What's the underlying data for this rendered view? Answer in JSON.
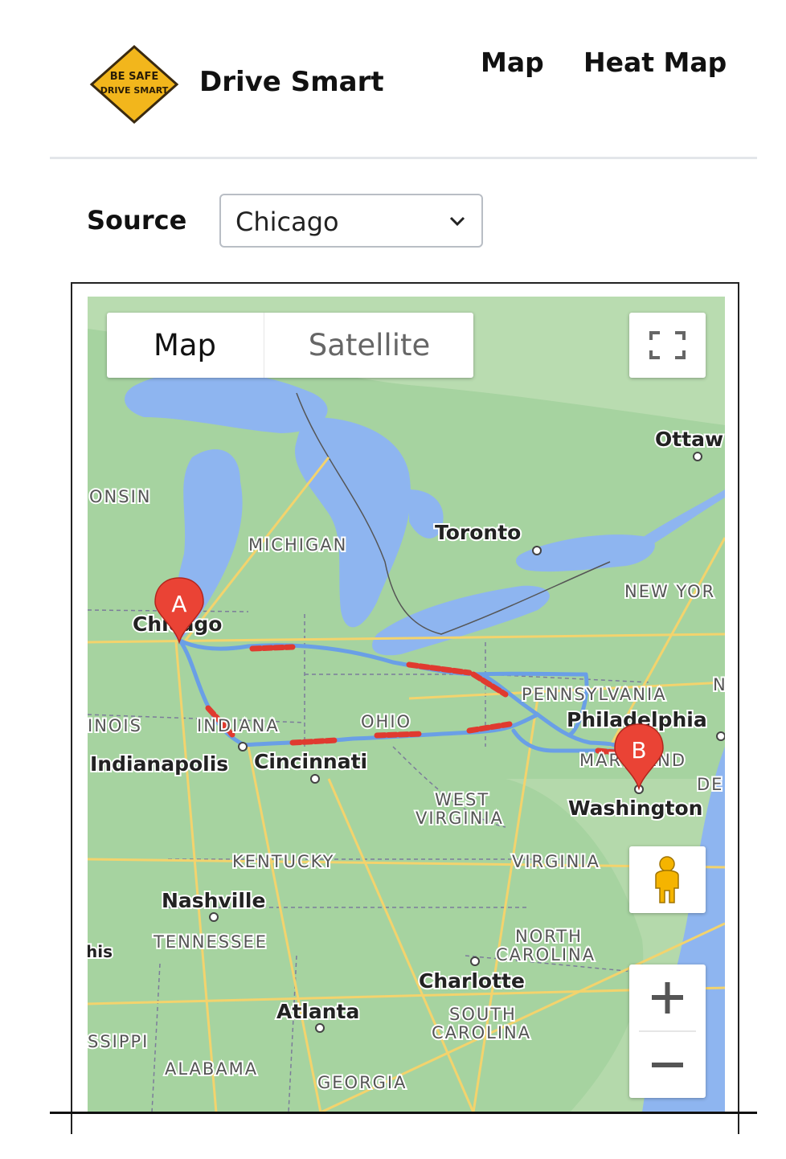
{
  "header": {
    "logo_text_line1": "BE SAFE",
    "logo_text_line2": "DRIVE SMART",
    "brand": "Drive Smart",
    "nav": [
      "Map",
      "Heat Map"
    ]
  },
  "source": {
    "label": "Source",
    "selected": "Chicago"
  },
  "map": {
    "type_control": {
      "map_label": "Map",
      "satellite_label": "Satellite",
      "selected": "Map"
    },
    "markers": {
      "start": "A",
      "end": "B"
    },
    "cities": [
      "Ottaw",
      "Toronto",
      "Chicago",
      "Philadelphia",
      "Indianapolis",
      "Cincinnati",
      "Washington",
      "Nashville",
      "Charlotte",
      "Atlanta",
      "his"
    ],
    "states": [
      "ONSIN",
      "MICHIGAN",
      "NEW YOR",
      "PENNSYLVANIA",
      "INOIS",
      "INDIANA",
      "OHIO",
      "MARYLAND",
      "DE",
      "N",
      "WEST",
      "VIRGINIA",
      "KENTUCKY",
      "VIRGINIA",
      "TENNESSEE",
      "NORTH",
      "CAROLINA",
      "SOUTH",
      "CAROLINA",
      "SSIPPI",
      "ALABAMA",
      "GEORGIA"
    ],
    "colors": {
      "land": "#9fd09a",
      "water": "#8eb5f0",
      "route": "#6a9fe6",
      "hotspot": "#e03a2f",
      "marker": "#ea4335"
    }
  }
}
